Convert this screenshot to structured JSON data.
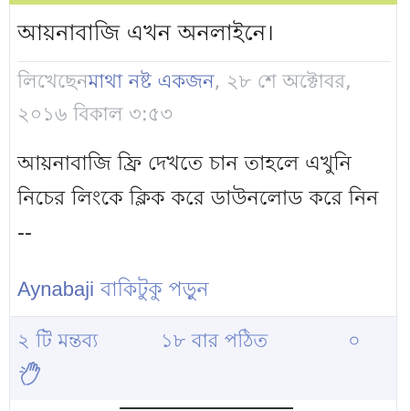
{
  "post": {
    "title": "আয়নাবাজি এখন অনলাইনে।",
    "meta_prefix": "লিখেছেন",
    "author": "মাথা নষ্ট একজন",
    "meta_date": ", ২৮ শে অক্টোবর, ২০১৬ বিকাল ৩:৫৩",
    "excerpt": "আয়নাবাজি ফ্রি দেখতে চান তাহলে এখুনি নিচের লিংকে ক্লিক করে ডাউনলোড করে নিন --",
    "keyword": "Aynabaji",
    "read_more": "বাকিটুকু পড়ুন"
  },
  "stats": {
    "comments": "২ টি মন্তব্য",
    "views": "১৮ বার পঠিত",
    "likes": "০"
  },
  "colors": {
    "accent": "#cfe27a",
    "link": "#5b6fb5",
    "meta": "#a0a6ad",
    "footer_bg": "#f3f5fb"
  },
  "icons": {
    "like": "hand-icon"
  }
}
